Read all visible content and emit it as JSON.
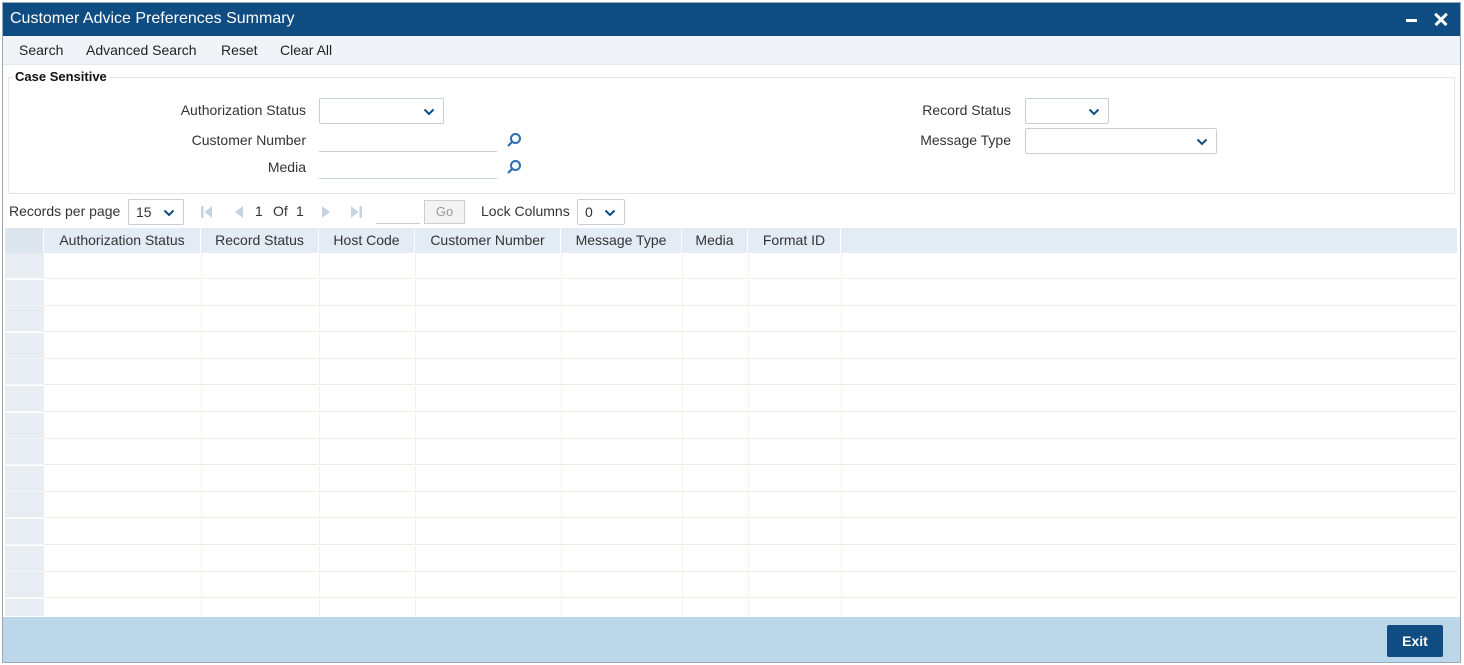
{
  "window": {
    "title": "Customer Advice Preferences Summary"
  },
  "toolbar": {
    "search": "Search",
    "advanced_search": "Advanced Search",
    "reset": "Reset",
    "clear_all": "Clear All"
  },
  "criteria": {
    "legend": "Case Sensitive",
    "authorization_status_label": "Authorization Status",
    "authorization_status_value": "",
    "customer_number_label": "Customer Number",
    "customer_number_value": "",
    "media_label": "Media",
    "media_value": "",
    "record_status_label": "Record Status",
    "record_status_value": "",
    "message_type_label": "Message Type",
    "message_type_value": ""
  },
  "pager": {
    "records_per_page_label": "Records per page",
    "records_per_page_value": "15",
    "current_page": "1",
    "of_label": "Of",
    "total_pages": "1",
    "go_label": "Go",
    "lock_columns_label": "Lock Columns",
    "lock_columns_value": "0"
  },
  "grid": {
    "columns": [
      "Authorization Status",
      "Record Status",
      "Host Code",
      "Customer Number",
      "Message Type",
      "Media",
      "Format ID"
    ],
    "rows": []
  },
  "footer": {
    "exit_label": "Exit"
  },
  "colors": {
    "title_bar": "#0f4c81",
    "footer": "#bcd6ea",
    "exit_button": "#0f4c81",
    "grid_header": "#e3ebf5"
  },
  "icons": {
    "lookup": "search-icon",
    "dropdown": "chevron-down-icon",
    "first_page": "first-page-icon",
    "prev_page": "prev-page-icon",
    "next_page": "next-page-icon",
    "last_page": "last-page-icon",
    "minimize": "minimize-icon",
    "close": "close-icon"
  }
}
